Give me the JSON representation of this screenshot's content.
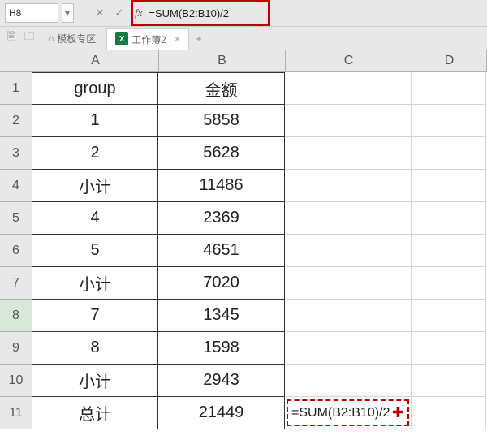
{
  "formula_bar": {
    "cell_ref": "H8",
    "formula": "=SUM(B2:B10)/2"
  },
  "tabs": {
    "template_area": "模板专区",
    "workbook": "工作簿2"
  },
  "columns": [
    "A",
    "B",
    "C",
    "D"
  ],
  "row_numbers": [
    "1",
    "2",
    "3",
    "4",
    "5",
    "6",
    "7",
    "8",
    "9",
    "10",
    "11"
  ],
  "grid": {
    "header": {
      "a": "group",
      "b": "金额"
    },
    "rows": [
      {
        "a": "1",
        "b": "5858"
      },
      {
        "a": "2",
        "b": "5628"
      },
      {
        "a": "小计",
        "b": "11486"
      },
      {
        "a": "4",
        "b": "2369"
      },
      {
        "a": "5",
        "b": "4651"
      },
      {
        "a": "小计",
        "b": "7020"
      },
      {
        "a": "7",
        "b": "1345"
      },
      {
        "a": "8",
        "b": "1598"
      },
      {
        "a": "小计",
        "b": "2943"
      },
      {
        "a": "总计",
        "b": "21449"
      }
    ],
    "overlay_formula": "=SUM(B2:B10)/2"
  },
  "icons": {
    "dropdown": "▾",
    "cancel": "✕",
    "accept": "✓",
    "fx": "fx",
    "home": "⌂",
    "folder": "🗀",
    "file": "🗎",
    "close": "×",
    "plus": "+"
  },
  "chart_data": {
    "type": "table",
    "title": "",
    "columns": [
      "group",
      "金额"
    ],
    "rows": [
      [
        "1",
        5858
      ],
      [
        "2",
        5628
      ],
      [
        "小计",
        11486
      ],
      [
        "4",
        2369
      ],
      [
        "5",
        4651
      ],
      [
        "小计",
        7020
      ],
      [
        "7",
        1345
      ],
      [
        "8",
        1598
      ],
      [
        "小计",
        2943
      ],
      [
        "总计",
        21449
      ]
    ],
    "total_formula": "=SUM(B2:B10)/2"
  }
}
